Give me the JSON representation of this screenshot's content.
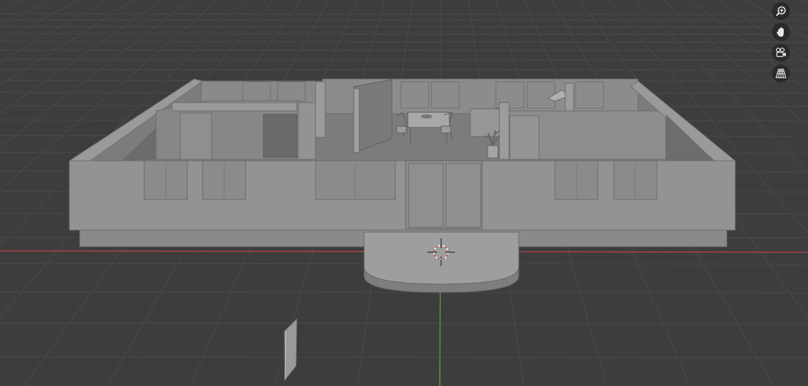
{
  "app": "3D viewport",
  "viewport": {
    "background_color": "#3d3d3d",
    "grid_color": "#4b4b4b",
    "x_axis_color": "#c8434b",
    "y_axis_color": "#5d9a2a",
    "model_color": "#8e8e8e"
  },
  "navigation_gizmo": [
    {
      "name": "zoom",
      "icon": "zoom-in-icon"
    },
    {
      "name": "pan",
      "icon": "hand-icon"
    },
    {
      "name": "camera",
      "icon": "camera-icon"
    },
    {
      "name": "projection",
      "icon": "grid-perspective-icon"
    }
  ],
  "scene_objects": [
    "house-model",
    "entrance-platform",
    "3d-cursor",
    "light-plane"
  ]
}
